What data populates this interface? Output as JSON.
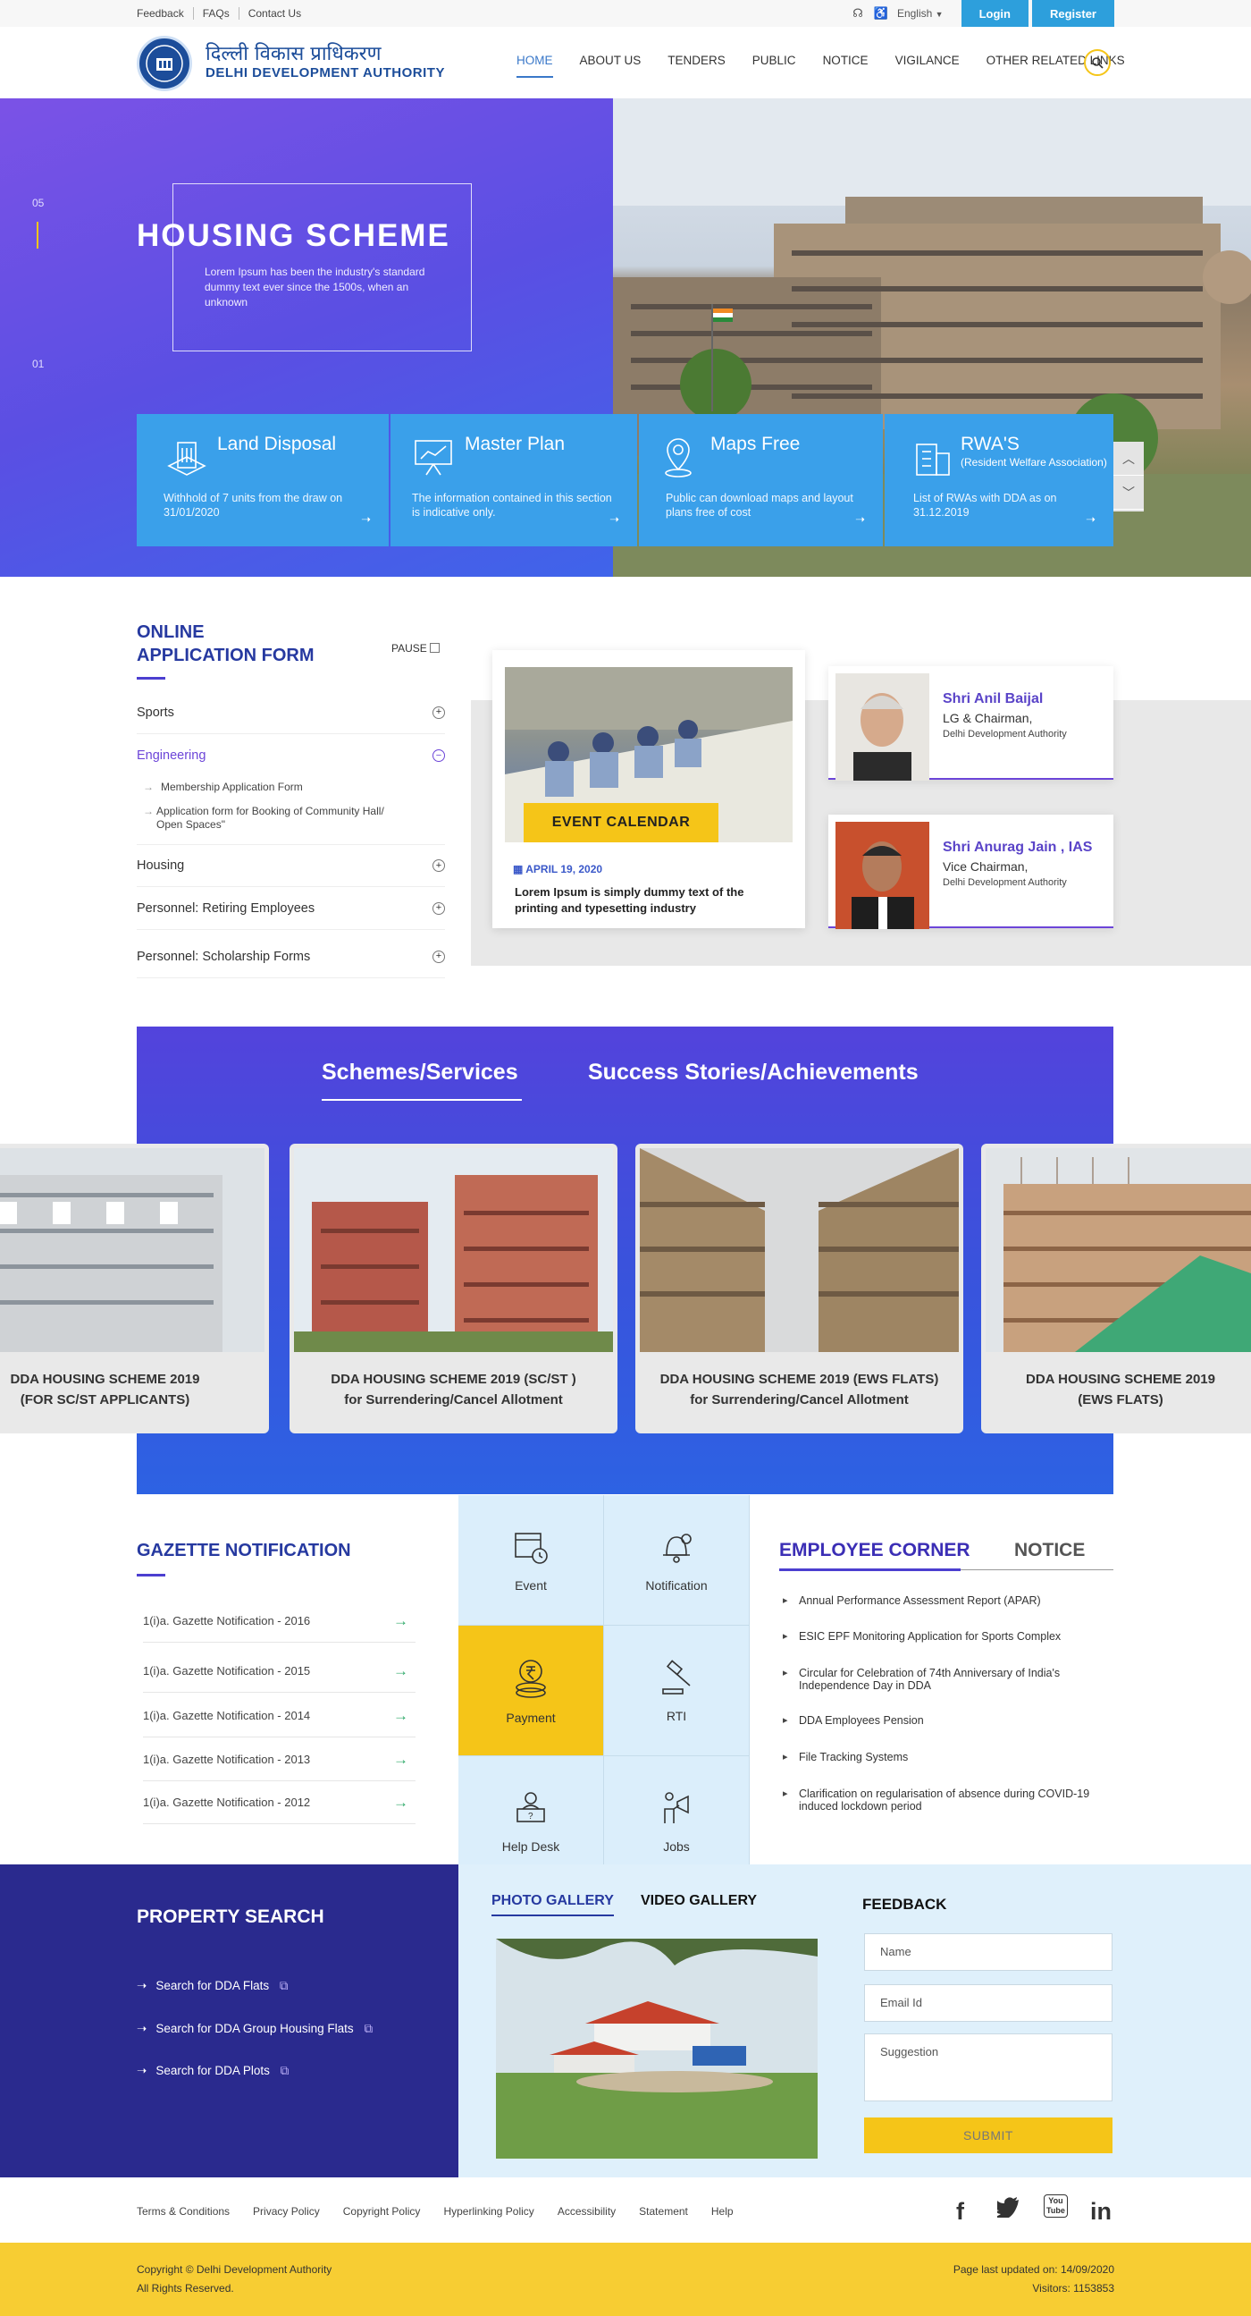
{
  "topbar": {
    "links": [
      "Feedback",
      "FAQs",
      "Contact Us"
    ],
    "language": "English",
    "login": "Login",
    "register": "Register"
  },
  "header": {
    "logo_hindi": "दिल्ली विकास प्राधिकरण",
    "logo_english": "DELHI DEVELOPMENT AUTHORITY",
    "nav": [
      "HOME",
      "ABOUT US",
      "TENDERS",
      "PUBLIC",
      "NOTICE",
      "VIGILANCE",
      "OTHER RELATED LINKS"
    ],
    "active_nav": "HOME"
  },
  "hero": {
    "title": "HOUSING SCHEME",
    "description": "Lorem Ipsum has been the industry's standard dummy text ever since the 1500s, when an unknown",
    "slide_top": "05",
    "slide_bottom": "01",
    "cards": [
      {
        "title": "Land Disposal",
        "subtitle": "",
        "desc": "Withhold of 7 units from the draw on 31/01/2020",
        "icon": "building-icon"
      },
      {
        "title": "Master Plan",
        "subtitle": "",
        "desc": "The information contained in this section is indicative only.",
        "icon": "presentation-icon"
      },
      {
        "title": "Maps Free",
        "subtitle": "",
        "desc": "Public can download maps and layout plans free of cost",
        "icon": "map-pin-icon"
      },
      {
        "title": "RWA'S",
        "subtitle": "(Resident Welfare Association)",
        "desc": "List of RWAs with DDA as on 31.12.2019",
        "icon": "apartment-icon"
      }
    ]
  },
  "online_application": {
    "title_line1": "ONLINE",
    "title_line2": "APPLICATION FORM",
    "pause": "PAUSE",
    "items": [
      "Sports",
      "Engineering",
      "Housing",
      "Personnel: Retiring Employees",
      "Personnel: Scholarship Forms"
    ],
    "engineering_sub": [
      "Membership Application Form",
      "Application form for Booking of Community Hall/ Open Spaces\""
    ]
  },
  "event": {
    "label": "EVENT CALENDAR",
    "date": "APRIL 19, 2020",
    "text": "Lorem Ipsum is simply dummy text of the printing and typesetting industry"
  },
  "officials": [
    {
      "name": "Shri Anil Baijal",
      "role": "LG & Chairman,",
      "org": "Delhi Development Authority"
    },
    {
      "name": "Shri Anurag Jain , IAS",
      "role": "Vice Chairman,",
      "org": "Delhi Development Authority"
    }
  ],
  "schemes": {
    "tabs": [
      "Schemes/Services",
      "Success Stories/Achievements"
    ],
    "cards": [
      {
        "line1": "DDA HOUSING SCHEME 2019",
        "line2": "(FOR SC/ST APPLICANTS)"
      },
      {
        "line1": "DDA HOUSING SCHEME 2019 (SC/ST )",
        "line2": "for Surrendering/Cancel Allotment"
      },
      {
        "line1": "DDA HOUSING SCHEME 2019 (EWS FLATS)",
        "line2": "for Surrendering/Cancel Allotment"
      },
      {
        "line1": "DDA HOUSING SCHEME 2019",
        "line2": "(EWS FLATS)"
      }
    ]
  },
  "gazette": {
    "title": "GAZETTE NOTIFICATION",
    "items": [
      "1(i)a. Gazette Notification - 2016",
      "1(i)a. Gazette Notification - 2015",
      "1(i)a. Gazette Notification - 2014",
      "1(i)a. Gazette Notification - 2013",
      "1(i)a. Gazette Notification - 2012"
    ]
  },
  "tiles": [
    "Event",
    "Notification",
    "Payment",
    "RTI",
    "Help Desk",
    "Jobs"
  ],
  "employee_corner": {
    "tab_active": "EMPLOYEE CORNER",
    "tab_other": "NOTICE",
    "items": [
      "Annual Performance Assessment Report (APAR)",
      "ESIC EPF Monitoring Application for Sports Complex",
      "Circular for Celebration of 74th Anniversary of India's Independence Day in DDA",
      "DDA Employees Pension",
      "File Tracking Systems",
      "Clarification on regularisation of absence during COVID-19 induced lockdown period"
    ]
  },
  "property_search": {
    "title": "PROPERTY SEARCH",
    "items": [
      "Search for DDA Flats",
      "Search for DDA Group Housing Flats",
      "Search for DDA Plots"
    ]
  },
  "gallery": {
    "tab_active": "PHOTO GALLERY",
    "tab_other": "VIDEO GALLERY"
  },
  "feedback": {
    "title": "FEEDBACK",
    "name_placeholder": "Name",
    "email_placeholder": "Email Id",
    "suggestion_placeholder": "Suggestion",
    "submit": "SUBMIT"
  },
  "footer": {
    "links": [
      "Terms & Conditions",
      "Privacy Policy",
      "Copyright Policy",
      "Hyperlinking Policy",
      "Accessibility",
      "Statement",
      "Help"
    ],
    "copyright": "Copyright © Delhi Development Authority",
    "rights": "All Rights Reserved.",
    "updated": "Page last updated on: 14/09/2020",
    "visitors": "Visitors: 1153853",
    "social": [
      "f",
      "t",
      "You Tube",
      "in"
    ]
  },
  "colors": {
    "primary": "#2639a0",
    "accent": "#f5c518",
    "blue": "#3aa0ea",
    "purple": "#5a44c8"
  }
}
